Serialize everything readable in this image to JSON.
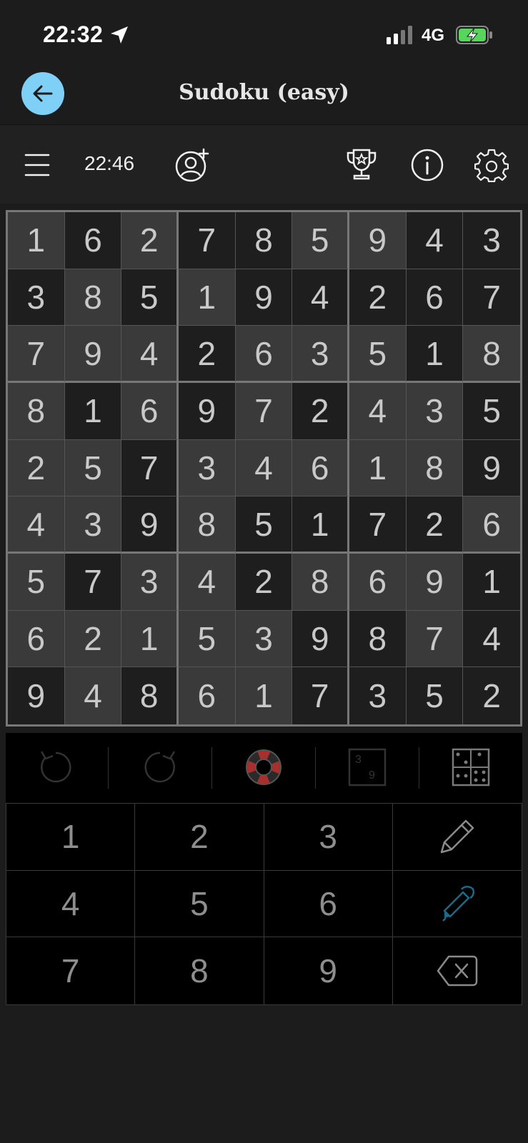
{
  "status_bar": {
    "time": "22:32",
    "network": "4G"
  },
  "header": {
    "title": "Sudoku (easy)"
  },
  "toolbar": {
    "timer": "22:46"
  },
  "board": [
    [
      "1",
      "6",
      "2",
      "7",
      "8",
      "5",
      "9",
      "4",
      "3"
    ],
    [
      "3",
      "8",
      "5",
      "1",
      "9",
      "4",
      "2",
      "6",
      "7"
    ],
    [
      "7",
      "9",
      "4",
      "2",
      "6",
      "3",
      "5",
      "1",
      "8"
    ],
    [
      "8",
      "1",
      "6",
      "9",
      "7",
      "2",
      "4",
      "3",
      "5"
    ],
    [
      "2",
      "5",
      "7",
      "3",
      "4",
      "6",
      "1",
      "8",
      "9"
    ],
    [
      "4",
      "3",
      "9",
      "8",
      "5",
      "1",
      "7",
      "2",
      "6"
    ],
    [
      "5",
      "7",
      "3",
      "4",
      "2",
      "8",
      "6",
      "9",
      "1"
    ],
    [
      "6",
      "2",
      "1",
      "5",
      "3",
      "9",
      "8",
      "7",
      "4"
    ],
    [
      "9",
      "4",
      "8",
      "6",
      "1",
      "7",
      "3",
      "5",
      "2"
    ]
  ],
  "board_shading": [
    "LDLDDLLDD",
    "DLDLDDDDD",
    "LLLDLLLDL",
    "LDLDLDLLD",
    "LLDLLLLLD",
    "LLDLDDDDL",
    "LDLLDLLLD",
    "LLLLLDDLD",
    "DLDLLDDDD"
  ],
  "tools": {
    "hint_icon": "lifebuoy-icon",
    "notes_label_top": "3",
    "notes_label_bottom": "9"
  },
  "keypad": {
    "digits": [
      "1",
      "2",
      "3",
      "4",
      "5",
      "6",
      "7",
      "8",
      "9"
    ]
  },
  "colors": {
    "accent": "#7fd0f7",
    "pen_active": "#1a6a8a",
    "lifebuoy": "#a8302c"
  }
}
